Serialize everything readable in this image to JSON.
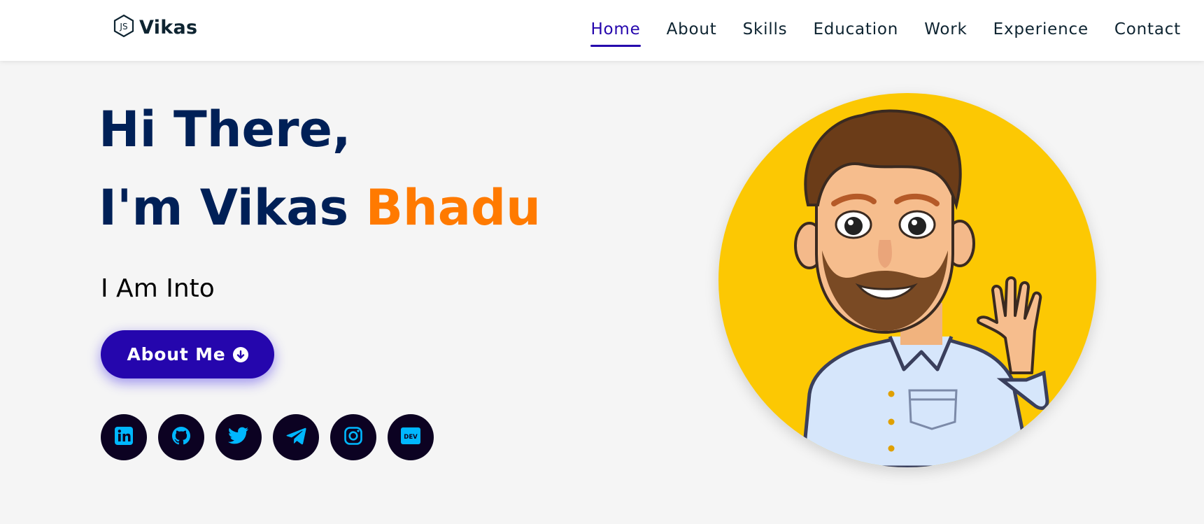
{
  "brand": {
    "logo_icon": "nodejs-js-hexagon-icon",
    "name": "Vikas"
  },
  "nav": {
    "items": [
      {
        "label": "Home",
        "active": true
      },
      {
        "label": "About"
      },
      {
        "label": "Skills"
      },
      {
        "label": "Education"
      },
      {
        "label": "Work"
      },
      {
        "label": "Experience"
      },
      {
        "label": "Contact"
      }
    ],
    "active_color": "#2506ad"
  },
  "hero": {
    "greeting": "Hi There,",
    "intro_prefix": "I'm Vikas ",
    "intro_highlight": "Bhadu",
    "tagline": "I Am Into",
    "button_label": "About Me",
    "button_icon": "arrow-circle-down-icon",
    "highlight_color": "#ff7a00",
    "title_color": "#002057"
  },
  "socials": [
    {
      "name": "linkedin-icon"
    },
    {
      "name": "github-icon"
    },
    {
      "name": "twitter-icon"
    },
    {
      "name": "telegram-icon"
    },
    {
      "name": "instagram-icon"
    },
    {
      "name": "dev-icon",
      "text": "DEV"
    }
  ],
  "avatar": {
    "description_icon": "waving-cartoon-avatar",
    "background_color": "#fcc803"
  }
}
